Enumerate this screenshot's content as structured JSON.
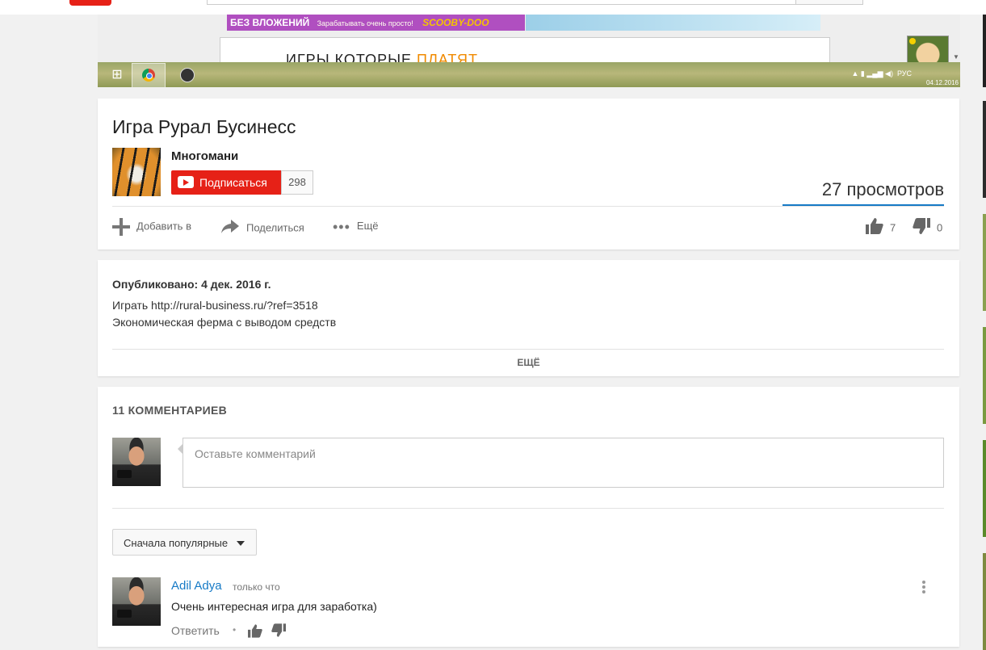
{
  "banner": {
    "ad_main": "БЕЗ ВЛОЖЕНИЙ",
    "ad_sub": "Зарабатывать очень просто!",
    "ad_brand": "SCOOBY-DOO",
    "site_heading_dark": "ИГРЫ КОТОРЫЕ ",
    "site_heading_orange": "ПЛАТЯТ"
  },
  "taskbar": {
    "lang": "РУС",
    "date": "04.12.2016"
  },
  "video": {
    "title": "Игра Рурал Бусинесс",
    "channel_name": "Многомани",
    "subscribe_label": "Подписаться",
    "subscriber_count": "298",
    "views": "27 просмотров",
    "actions": {
      "add": "Добавить в",
      "share": "Поделиться",
      "more": "Ещё"
    },
    "likes": "7",
    "dislikes": "0"
  },
  "description": {
    "published": "Опубликовано: 4 дек. 2016 г.",
    "line1": "Играть http://rural-business.ru/?ref=3518",
    "line2": "Экономическая ферма с выводом средств",
    "more": "ЕЩЁ"
  },
  "comments": {
    "count_label": "11 КОММЕНТАРИЕВ",
    "input_placeholder": "Оставьте комментарий",
    "sort_label": "Сначала популярные",
    "items": [
      {
        "author": "Adil Adya",
        "time": "только что",
        "text": "Очень интересная игра для заработка)",
        "reply": "Ответить",
        "separator": "•"
      }
    ]
  },
  "colors": {
    "accent_red": "#e62117",
    "link_blue": "#167ac6",
    "page_bg": "#f1f1f1"
  }
}
